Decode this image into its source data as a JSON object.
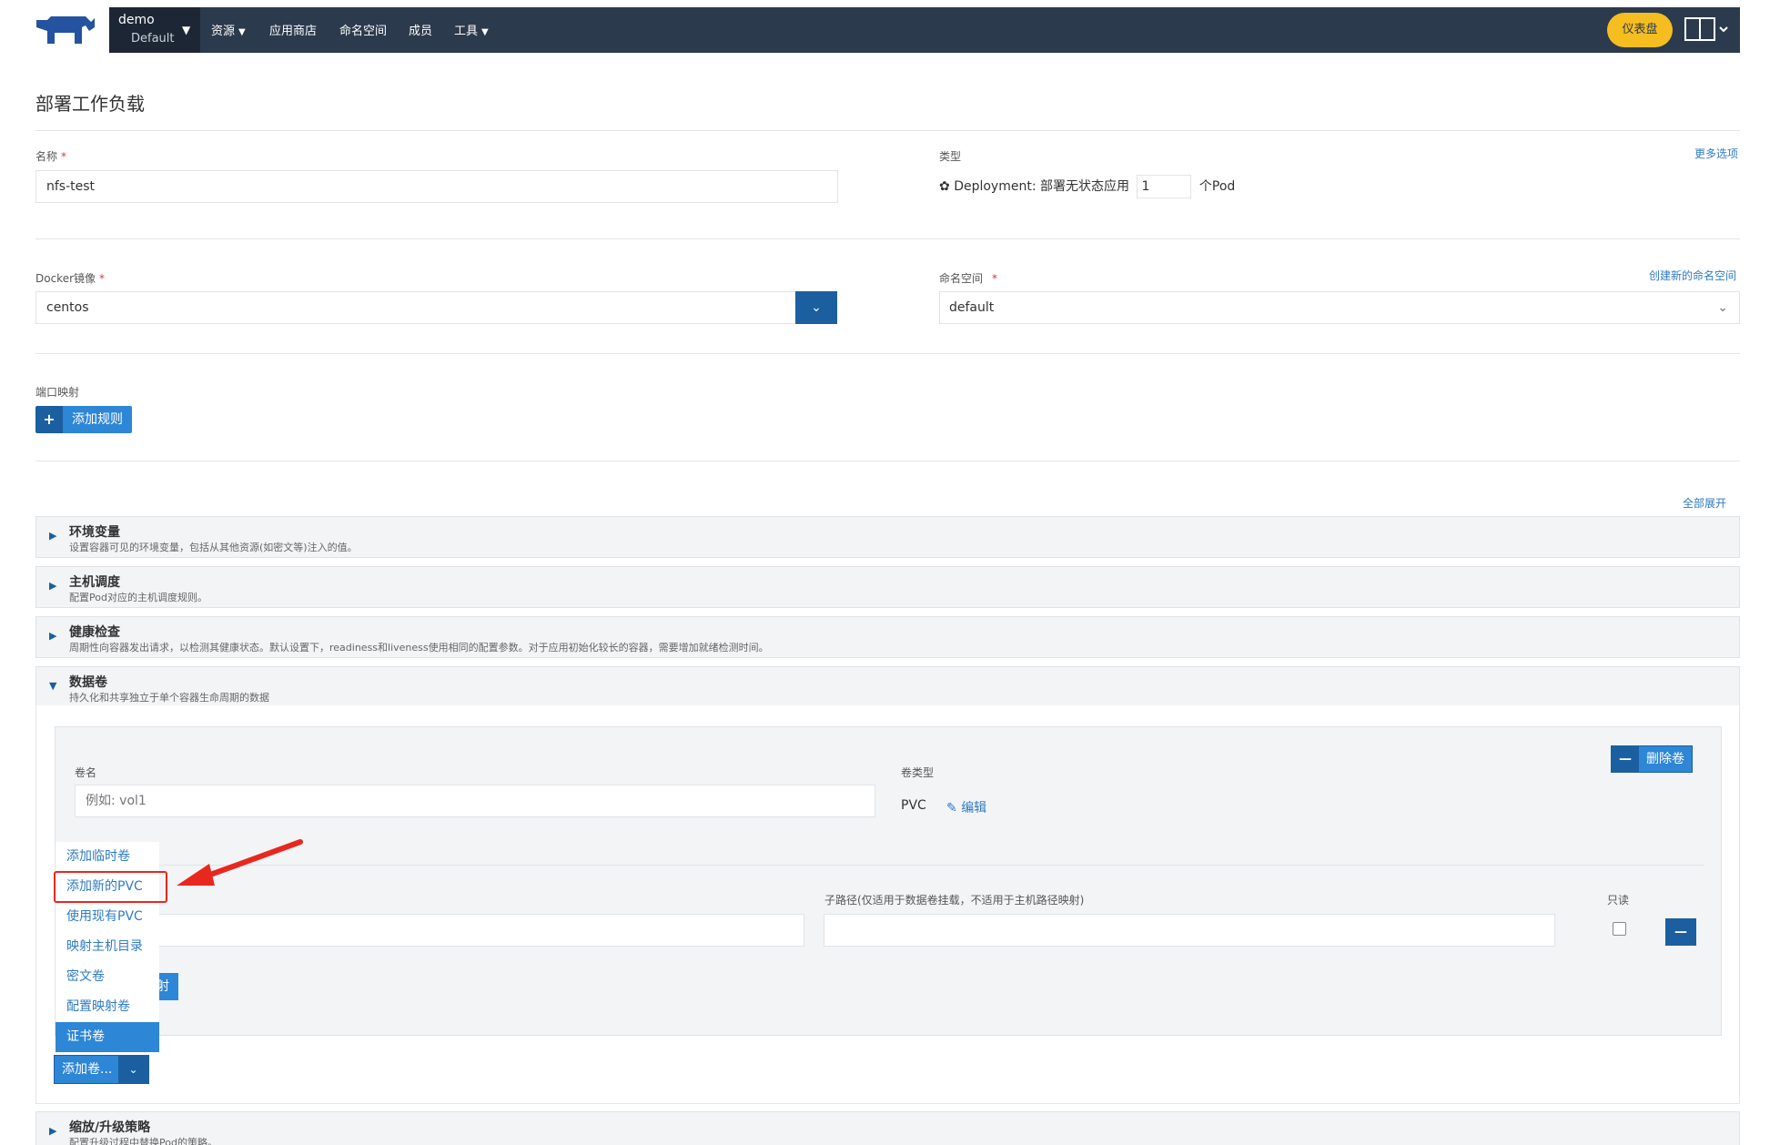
{
  "topbar": {
    "project_name": "demo",
    "project_sub": "Default",
    "nav_items": [
      "资源",
      "应用商店",
      "命名空间",
      "成员",
      "工具"
    ],
    "dashboard_label": "仪表盘"
  },
  "page": {
    "title": "部署工作负载",
    "name_label": "名称",
    "name_value": "nfs-test",
    "type_label": "类型",
    "more_options": "更多选项",
    "type_text": "Deployment: 部署无状态应用",
    "pod_count": "1",
    "pod_unit": "个Pod",
    "docker_label": "Docker镜像",
    "docker_value": "centos",
    "namespace_label": "命名空间",
    "create_namespace": "创建新的命名空间",
    "namespace_value": "default",
    "port_label": "端口映射",
    "add_rule": "添加规则",
    "expand_all": "全部展开"
  },
  "sections": [
    {
      "title": "环境变量",
      "desc": "设置容器可见的环境变量，包括从其他资源(如密文等)注入的值。"
    },
    {
      "title": "主机调度",
      "desc": "配置Pod对应的主机调度规则。"
    },
    {
      "title": "健康检查",
      "desc": "周期性向容器发出请求，以检测其健康状态。默认设置下，readiness和liveness使用相同的配置参数。对于应用初始化较长的容器，需要增加就绪检测时间。"
    },
    {
      "title": "数据卷",
      "desc": "持久化和共享独立于单个容器生命周期的数据"
    },
    {
      "title": "缩放/升级策略",
      "desc": "配置升级过程中替换Pod的策略。"
    }
  ],
  "volume": {
    "name_label": "卷名",
    "name_placeholder": "例如: vol1",
    "type_label": "卷类型",
    "type_value": "PVC",
    "edit_label": "编辑",
    "delete_label": "删除卷",
    "subpath_label": "子路径(仅适用于数据卷挂载，不适用于主机路径映射)",
    "readonly_label": "只读",
    "hidden_btn_partial": "射"
  },
  "volume_menu": {
    "items": [
      "添加临时卷",
      "添加新的PVC",
      "使用现有PVC",
      "映射主机目录",
      "密文卷",
      "配置映射卷",
      "证书卷"
    ],
    "active_index": 6,
    "highlighted_index": 1
  },
  "add_volume_button": "添加卷...",
  "colors": {
    "nav_bg": "#2c3a4d",
    "accent_blue": "#2d86d6",
    "dark_blue": "#1b5fa0",
    "dashboard_yellow": "#f5bd1f",
    "annotation_red": "#e8271f"
  }
}
